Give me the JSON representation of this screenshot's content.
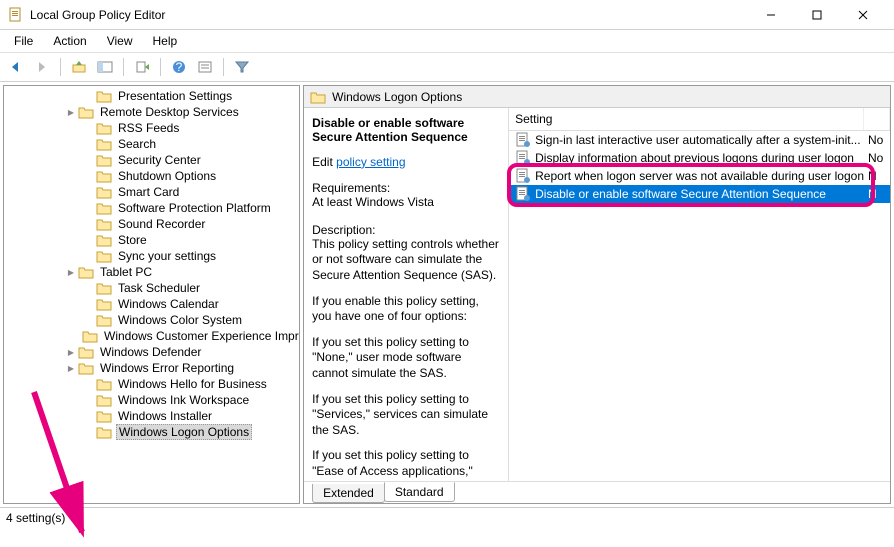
{
  "window": {
    "title": "Local Group Policy Editor"
  },
  "menu": {
    "items": [
      "File",
      "Action",
      "View",
      "Help"
    ]
  },
  "tree": {
    "indent_base": 60,
    "items": [
      {
        "label": "Presentation Settings",
        "expander": "",
        "indent": 78
      },
      {
        "label": "Remote Desktop Services",
        "expander": ">",
        "indent": 60
      },
      {
        "label": "RSS Feeds",
        "expander": "",
        "indent": 78
      },
      {
        "label": "Search",
        "expander": "",
        "indent": 78
      },
      {
        "label": "Security Center",
        "expander": "",
        "indent": 78
      },
      {
        "label": "Shutdown Options",
        "expander": "",
        "indent": 78
      },
      {
        "label": "Smart Card",
        "expander": "",
        "indent": 78
      },
      {
        "label": "Software Protection Platform",
        "expander": "",
        "indent": 78
      },
      {
        "label": "Sound Recorder",
        "expander": "",
        "indent": 78
      },
      {
        "label": "Store",
        "expander": "",
        "indent": 78
      },
      {
        "label": "Sync your settings",
        "expander": "",
        "indent": 78
      },
      {
        "label": "Tablet PC",
        "expander": ">",
        "indent": 60
      },
      {
        "label": "Task Scheduler",
        "expander": "",
        "indent": 78
      },
      {
        "label": "Windows Calendar",
        "expander": "",
        "indent": 78
      },
      {
        "label": "Windows Color System",
        "expander": "",
        "indent": 78
      },
      {
        "label": "Windows Customer Experience Improvement Program",
        "expander": "",
        "indent": 78
      },
      {
        "label": "Windows Defender",
        "expander": ">",
        "indent": 60
      },
      {
        "label": "Windows Error Reporting",
        "expander": ">",
        "indent": 60
      },
      {
        "label": "Windows Hello for Business",
        "expander": "",
        "indent": 78
      },
      {
        "label": "Windows Ink Workspace",
        "expander": "",
        "indent": 78
      },
      {
        "label": "Windows Installer",
        "expander": "",
        "indent": 78
      },
      {
        "label": "Windows Logon Options",
        "expander": "",
        "indent": 78,
        "selected": true
      }
    ]
  },
  "right": {
    "header_title": "Windows Logon Options",
    "detail": {
      "selected_policy": "Disable or enable software Secure Attention Sequence",
      "edit_label": "Edit",
      "edit_link": "policy setting",
      "requirements_label": "Requirements:",
      "requirements_value": "At least Windows Vista",
      "description_label": "Description:",
      "desc_p1": "This policy setting controls whether or not software can simulate the Secure Attention Sequence (SAS).",
      "desc_p2": "If you enable this policy setting, you have one of four options:",
      "desc_p3": "If you set this policy setting to \"None,\" user mode software cannot simulate the SAS.",
      "desc_p4": "If you set this policy setting to \"Services,\" services can simulate the SAS.",
      "desc_p5": "If you set this policy setting to \"Ease of Access applications,\""
    },
    "columns": {
      "setting": "Setting",
      "state": ""
    },
    "rows": [
      {
        "label": "Sign-in last interactive user automatically after a system-init...",
        "state": "No"
      },
      {
        "label": "Display information about previous logons during user logon",
        "state": "No"
      },
      {
        "label": "Report when logon server was not available during user logon",
        "state": "N"
      },
      {
        "label": "Disable or enable software Secure Attention Sequence",
        "state": "N",
        "selected": true
      }
    ],
    "tabs": {
      "extended": "Extended",
      "standard": "Standard"
    }
  },
  "statusbar": "4 setting(s)"
}
